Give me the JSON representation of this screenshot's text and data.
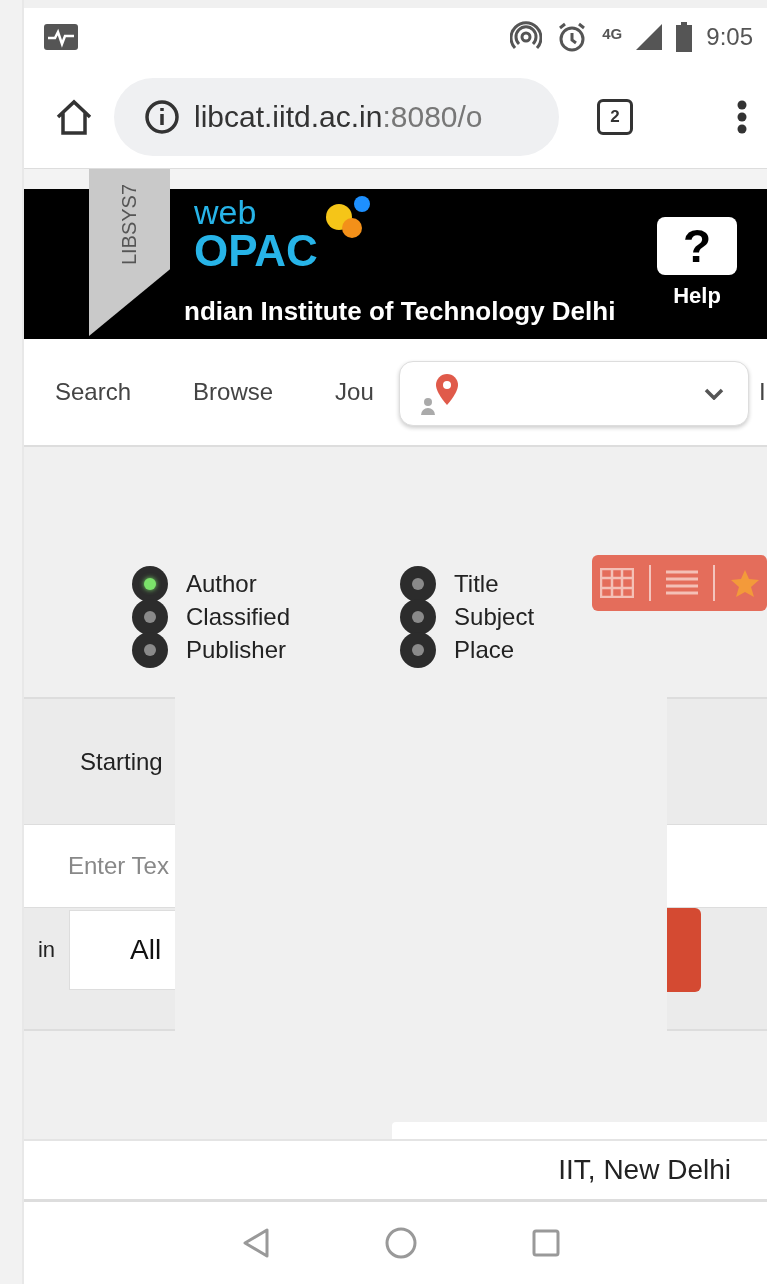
{
  "status_bar": {
    "network": "4G",
    "time": "9:05"
  },
  "browser": {
    "url_host": "libcat.iitd.ac.in",
    "url_rest": ":8080/o",
    "tab_count": "2"
  },
  "header": {
    "ribbon": "LIBSYS7",
    "logo_small": "web",
    "logo_big": "OPAC",
    "title": "ndian Institute of Technology Delhi",
    "help_glyph": "?",
    "help_label": "Help"
  },
  "nav": {
    "items": [
      {
        "label": "Search"
      },
      {
        "label": "Browse"
      },
      {
        "label": "Jou"
      },
      {
        "label": "I"
      }
    ]
  },
  "search_by": {
    "columns": [
      [
        {
          "label": "Author",
          "selected": true
        },
        {
          "label": "Classified",
          "selected": false
        },
        {
          "label": "Publisher",
          "selected": false
        }
      ],
      [
        {
          "label": "Title",
          "selected": false
        },
        {
          "label": "Subject",
          "selected": false
        },
        {
          "label": "Place",
          "selected": false
        }
      ]
    ]
  },
  "query": {
    "mode_label": "Starting",
    "placeholder": "Enter Tex",
    "in_label": "in",
    "collection": "All"
  },
  "footer": {
    "text": "IIT, New Delhi"
  }
}
